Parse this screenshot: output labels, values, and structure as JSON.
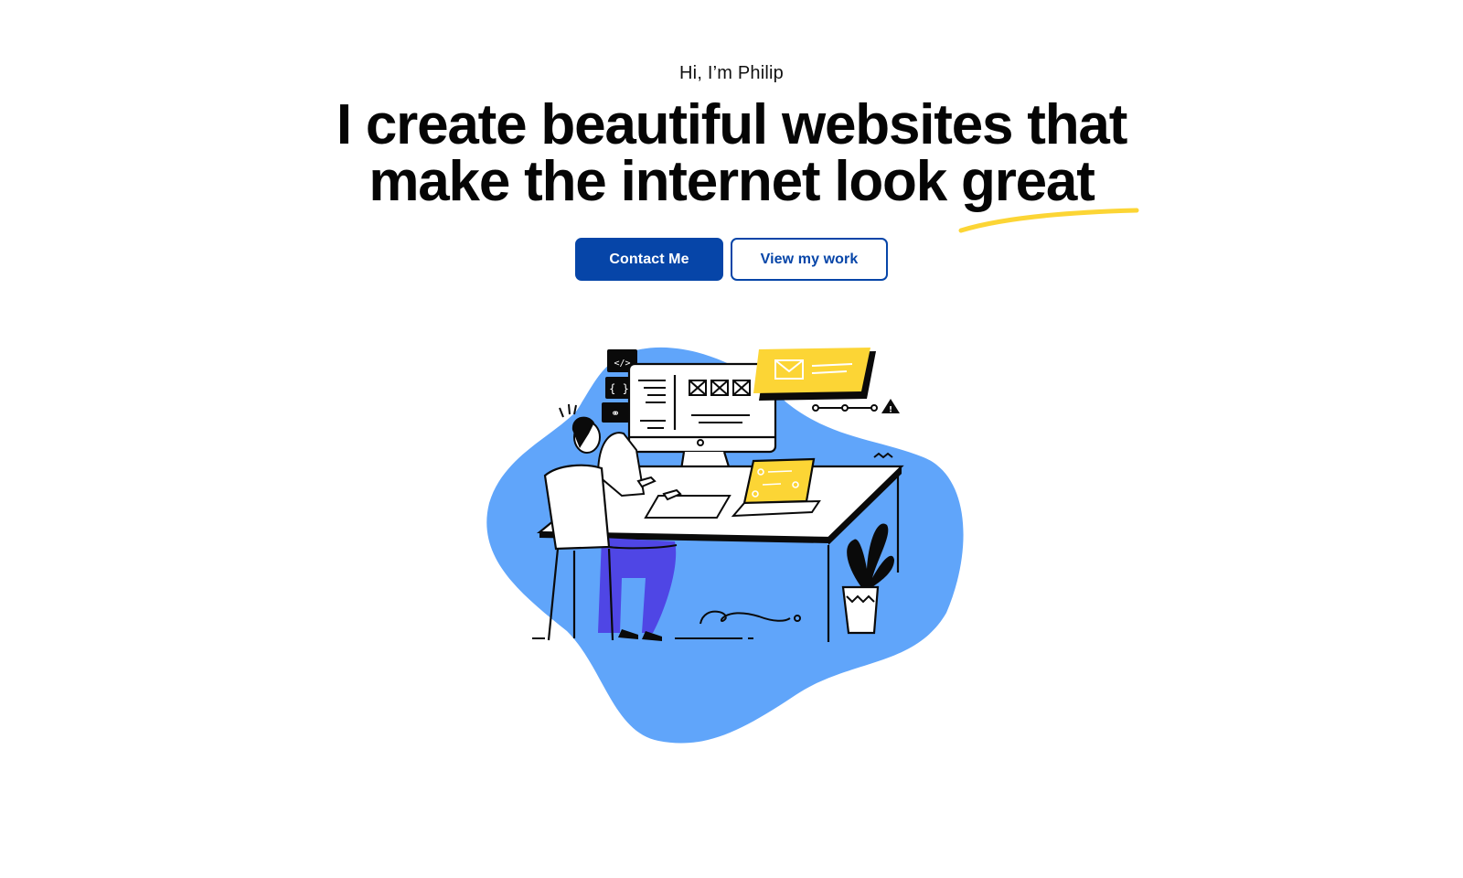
{
  "hero": {
    "greeting": "Hi, I’m Philip",
    "headline_line1": "I create beautiful websites that",
    "headline_line2_prefix": "make the internet look ",
    "headline_highlight": "great"
  },
  "actions": {
    "primary_label": "Contact Me",
    "secondary_label": "View my work"
  },
  "colors": {
    "brand_blue": "#0645a8",
    "blob_blue": "#60a5fa",
    "accent_yellow": "#fcd535",
    "pants_purple": "#4f46e5"
  },
  "illustration": {
    "subject": "developer-at-desk-illustration",
    "icons": [
      "code-tag-icon",
      "curly-braces-icon",
      "link-icon",
      "envelope-icon",
      "warning-icon",
      "plant-icon"
    ]
  }
}
